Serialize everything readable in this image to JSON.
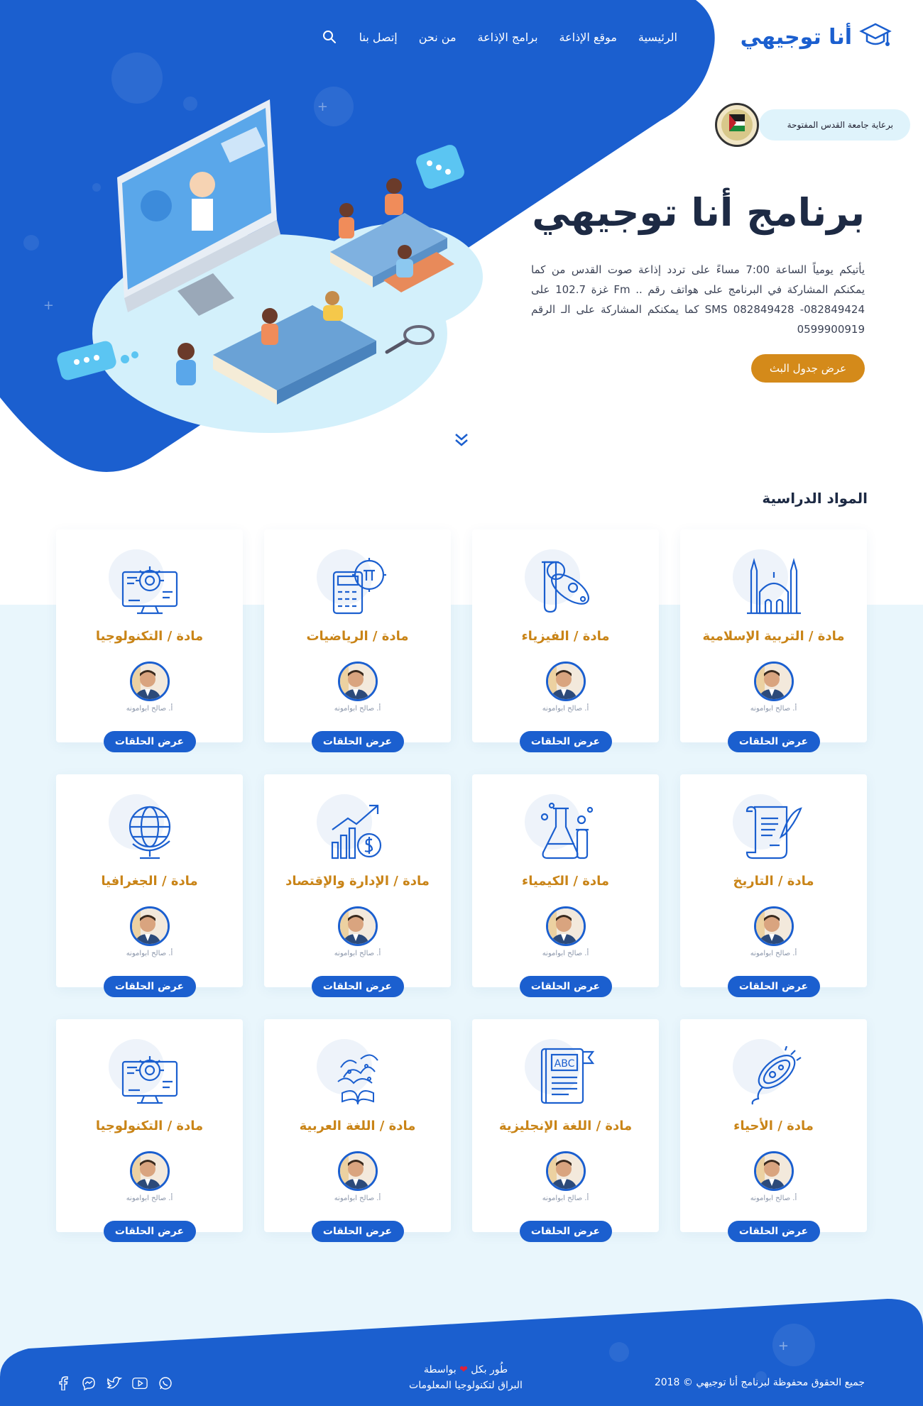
{
  "brand": {
    "name": "أنا توجيهي"
  },
  "nav": {
    "items": [
      "الرئيسية",
      "موقع الإذاعة",
      "برامج الإذاعة",
      "من نحن",
      "إتصل بنا"
    ]
  },
  "hero": {
    "sponsor_text": "برعاية جامعة القدس المفتوحة",
    "title": "برنامج أنا توجيهي",
    "description": "يأتيكم يومياً الساعة 7:00 مساءً على تردد إذاعة صوت القدس من كما يمكنكم المشاركة في البرنامج على هواتف رقم .. Fm غزة 102.7 على SMS 082849428 -082849424 كما يمكنكم المشاركة على الـ الرقم 0599900919",
    "cta": "عرض جدول البث"
  },
  "subjects": {
    "title": "المواد الدراسية",
    "button_label": "عرض الحلقات",
    "teacher": "أ. صالح ابوامونه",
    "items": [
      {
        "title": "مادة / التربية الإسلامية",
        "icon": "mosque-icon"
      },
      {
        "title": "مادة / الفيزياء",
        "icon": "physics-icon"
      },
      {
        "title": "مادة / الرياضيات",
        "icon": "calculator-icon"
      },
      {
        "title": "مادة / التكنولوجيا",
        "icon": "computer-gear-icon"
      },
      {
        "title": "مادة / التاريخ",
        "icon": "scroll-icon"
      },
      {
        "title": "مادة / الكيمياء",
        "icon": "chemistry-icon"
      },
      {
        "title": "مادة / الإدارة والإقتصاد",
        "icon": "growth-chart-icon"
      },
      {
        "title": "مادة / الجغرافيا",
        "icon": "globe-icon"
      },
      {
        "title": "مادة / الأحياء",
        "icon": "bacteria-icon"
      },
      {
        "title": "مادة / اللغة الإنجليزية",
        "icon": "abc-book-icon"
      },
      {
        "title": "مادة / اللغة العربية",
        "icon": "arabic-book-icon"
      },
      {
        "title": "مادة / التكنولوجيا",
        "icon": "computer-gear-icon"
      }
    ]
  },
  "footer": {
    "copyright": "جميع الحقوق محفوظة لبرنامج أنا توجيهي © 2018",
    "dev_line1_a": "طُور بكل",
    "dev_line1_b": "بواسطة",
    "dev_line2": "البراق لتكنولوجيا المعلومات",
    "socials": [
      "whatsapp-icon",
      "youtube-icon",
      "twitter-icon",
      "messenger-icon",
      "facebook-icon"
    ]
  },
  "colors": {
    "primary": "#1b5fcf",
    "accent": "#d48a1a",
    "light_bg": "#e9f6fc"
  }
}
